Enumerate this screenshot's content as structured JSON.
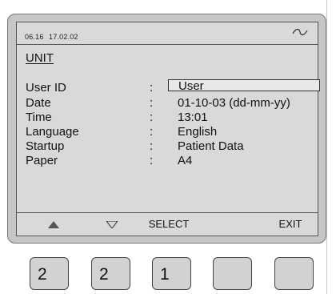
{
  "status_bar": {
    "time": "06.16",
    "date": "17.02.02",
    "signal_icon": "waveform-icon"
  },
  "section_title": "UNIT",
  "fields": [
    {
      "label": "User ID",
      "separator": ":",
      "value": "User",
      "selected": true
    },
    {
      "label": "Date",
      "separator": ":",
      "value": "01-10-03 (dd-mm-yy)"
    },
    {
      "label": "Time",
      "separator": ":",
      "value": "13:01"
    },
    {
      "label": "Language",
      "separator": ":",
      "value": "English"
    },
    {
      "label": "Startup",
      "separator": ":",
      "value": "Patient Data"
    },
    {
      "label": "Paper",
      "separator": ":",
      "value": "A4"
    }
  ],
  "softkeys": {
    "up_icon": "triangle-up-icon",
    "down_icon": "triangle-down-icon",
    "select_label": "SELECT",
    "exit_label": "EXIT"
  },
  "hardware_buttons": [
    {
      "label": "2"
    },
    {
      "label": "2"
    },
    {
      "label": "1"
    },
    {
      "label": ""
    },
    {
      "label": ""
    }
  ],
  "colors": {
    "screen_bg": "#d9d9d9",
    "bezel": "#c6c6c6",
    "button_face": "#d2d2d2"
  }
}
